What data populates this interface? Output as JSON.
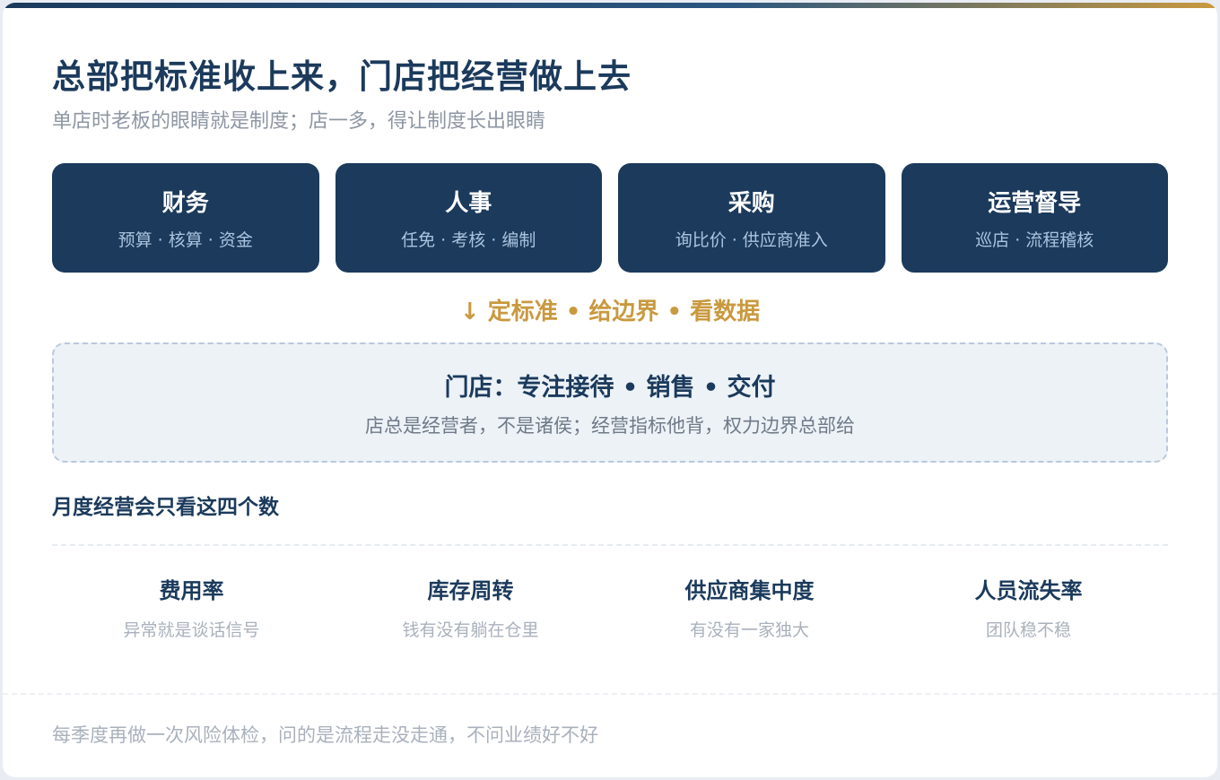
{
  "header": {
    "title": "总部把标准收上来，门店把经营做上去",
    "subtitle": "单店时老板的眼睛就是制度；店一多，得让制度长出眼睛"
  },
  "departments": [
    {
      "name": "财务",
      "desc": "预算 · 核算 · 资金"
    },
    {
      "name": "人事",
      "desc": "任免 · 考核 · 编制"
    },
    {
      "name": "采购",
      "desc": "询比价 · 供应商准入"
    },
    {
      "name": "运营督导",
      "desc": "巡店 · 流程稽核"
    }
  ],
  "flow": {
    "arrow_label": "↓ 定标准 • 给边界 • 看数据"
  },
  "store": {
    "title": "门店：专注接待 • 销售 • 交付",
    "subtitle": "店总是经营者，不是诸侯；经营指标他背，权力边界总部给"
  },
  "metrics": {
    "title": "月度经营会只看这四个数",
    "items": [
      {
        "name": "费用率",
        "desc": "异常就是谈话信号"
      },
      {
        "name": "库存周转",
        "desc": "钱有没有躺在仓里"
      },
      {
        "name": "供应商集中度",
        "desc": "有没有一家独大"
      },
      {
        "name": "人员流失率",
        "desc": "团队稳不稳"
      }
    ]
  },
  "footer": {
    "note": "每季度再做一次风险体检，问的是流程走没走通，不问业绩好不好"
  },
  "colors": {
    "primary": "#1b3a5c",
    "accent": "#c9993f",
    "store_bg": "#edf2f7"
  }
}
